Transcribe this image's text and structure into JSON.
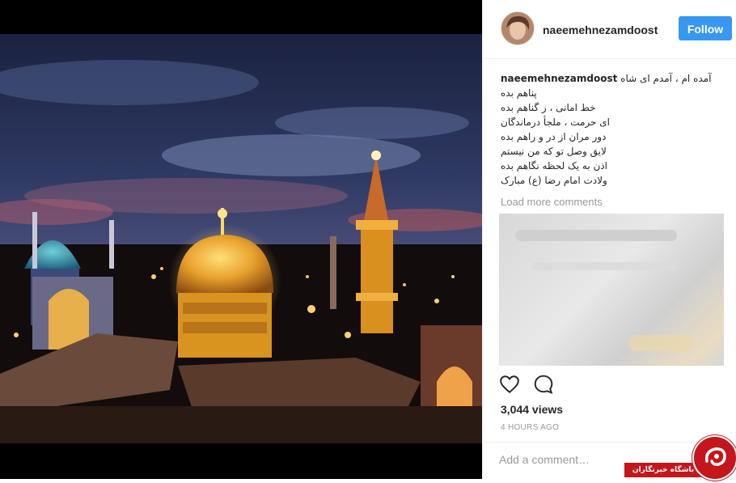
{
  "post": {
    "username": "naeemehnezamdoost",
    "follow_label": "Follow",
    "caption_user": "naeemehnezamdoost",
    "caption_lines": [
      "آمده ام ، آمدم ای شاه پناهم بده",
      "خط امانی ، ز گناهم بده",
      "ای حرمت ، ملجأ درماندگان",
      "دور مران از در و راهم بده",
      "لایق وصل تو که من نیستم",
      "اذن به یک لحظه نگاهم بده",
      "ولادت امام رضا (ع) مبارک"
    ],
    "load_more": "Load more comments",
    "views": "3,044 views",
    "time": "4 HOURS AGO",
    "add_comment_placeholder": "Add a comment…"
  },
  "icons": {
    "like": "heart-icon",
    "comment": "speech-bubble-icon"
  },
  "watermark": {
    "text": "باشگاه خبرنگاران"
  },
  "colors": {
    "follow_button": "#3897f0",
    "watermark": "#c4161c",
    "muted_text": "#999999"
  }
}
